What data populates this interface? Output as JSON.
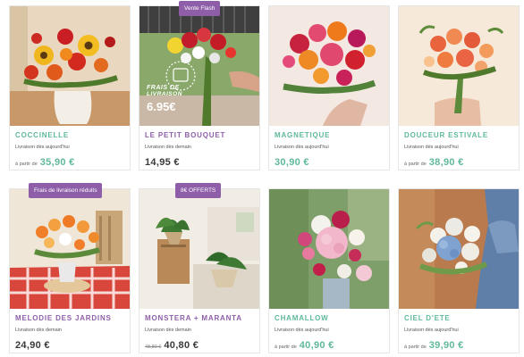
{
  "colors": {
    "purple": "#8e5fa8",
    "teal": "#5fb99a",
    "price_dark": "#3a3a3a",
    "badge": "#8e5fa8"
  },
  "products": [
    {
      "name": "COCCINELLE",
      "name_color": "#5fb99a",
      "delivery": "Livraison dès aujourd'hui",
      "price_prefix": "à partir de",
      "price": "35,90 €",
      "price_color": "#5fb99a",
      "old_price": ""
    },
    {
      "name": "LE PETIT BOUQUET",
      "name_color": "#8e5fa8",
      "delivery": "Livraison dès demain",
      "price_prefix": "",
      "price": "14,95 €",
      "price_color": "#3a3a3a",
      "old_price": "",
      "badge": "Vente Flash",
      "promo": {
        "line1": "FRAIS DE",
        "line2": "LIVRAISON",
        "line3": "6.95€"
      }
    },
    {
      "name": "MAGNETIQUE",
      "name_color": "#5fb99a",
      "delivery": "Livraison dès aujourd'hui",
      "price_prefix": "",
      "price": "30,90 €",
      "price_color": "#5fb99a",
      "old_price": ""
    },
    {
      "name": "DOUCEUR ESTIVALE",
      "name_color": "#5fb99a",
      "delivery": "Livraison dès aujourd'hui",
      "price_prefix": "à partir de",
      "price": "38,90 €",
      "price_color": "#5fb99a",
      "old_price": ""
    },
    {
      "name": "MELODIE DES JARDINS",
      "name_color": "#8e5fa8",
      "delivery": "Livraison dès demain",
      "price_prefix": "",
      "price": "24,90 €",
      "price_color": "#3a3a3a",
      "old_price": "",
      "badge": "Frais de livraison réduits"
    },
    {
      "name": "MONSTERA + MARANTA",
      "name_color": "#8e5fa8",
      "delivery": "Livraison dès demain",
      "price_prefix": "",
      "price": "40,80 €",
      "price_color": "#3a3a3a",
      "old_price": "48,80 €",
      "badge": "8€ OFFERTS"
    },
    {
      "name": "CHAMALLOW",
      "name_color": "#5fb99a",
      "delivery": "Livraison dès aujourd'hui",
      "price_prefix": "à partir de",
      "price": "40,90 €",
      "price_color": "#5fb99a",
      "old_price": ""
    },
    {
      "name": "CIEL D'ETE",
      "name_color": "#5fb99a",
      "delivery": "Livraison dès aujourd'hui",
      "price_prefix": "à partir de",
      "price": "39,90 €",
      "price_color": "#5fb99a",
      "old_price": ""
    }
  ]
}
